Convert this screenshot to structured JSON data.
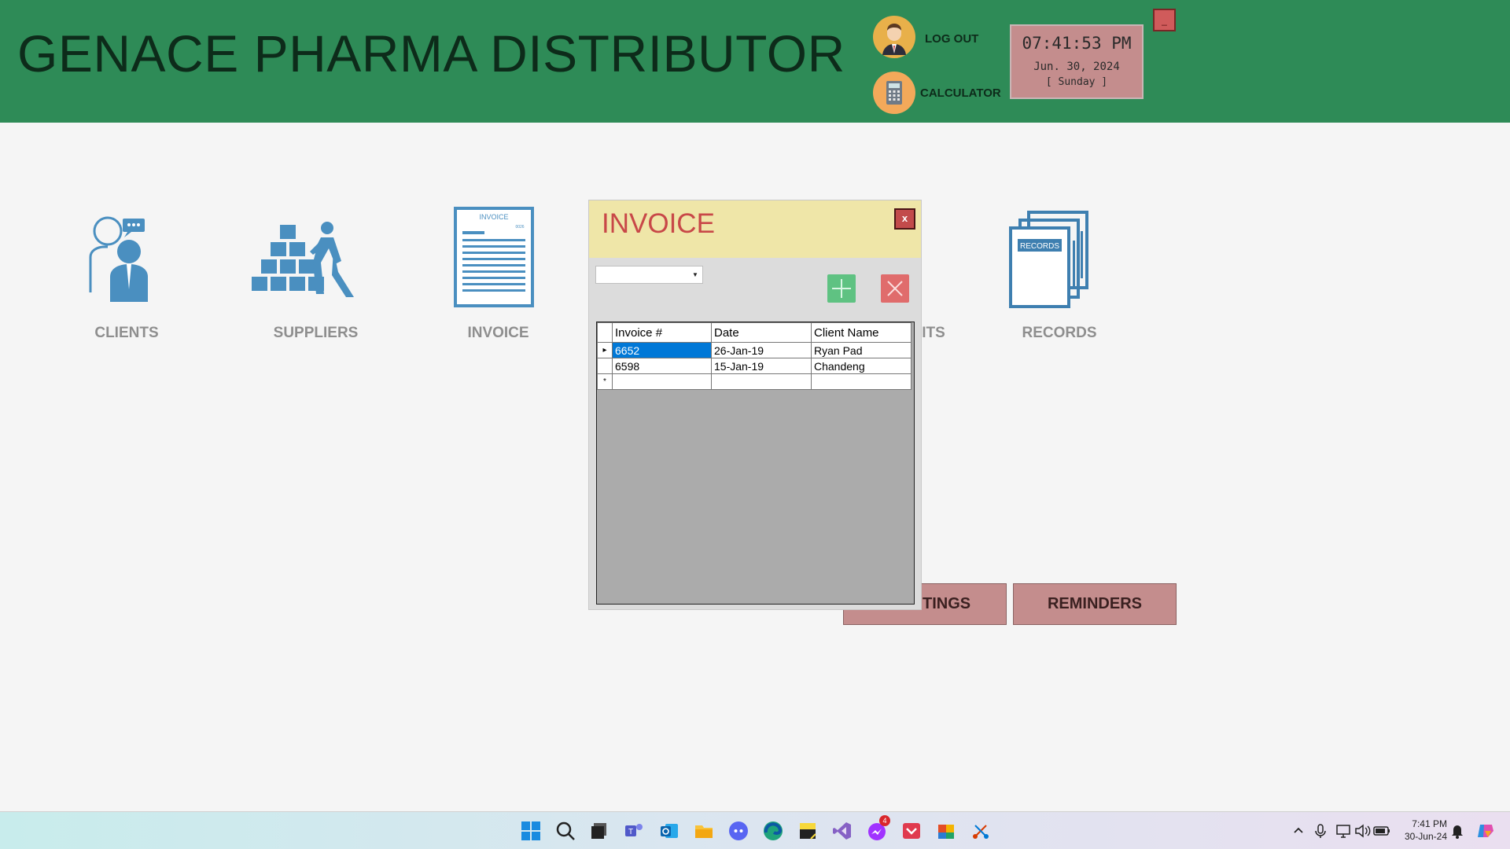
{
  "header": {
    "title": "GENACE PHARMA DISTRIBUTOR",
    "logout_label": "LOG OUT",
    "calculator_label": "CALCULATOR",
    "clock": {
      "time": "07:41:53 PM",
      "date": "Jun. 30, 2024",
      "day": "[ Sunday ]"
    },
    "minimize_label": "_"
  },
  "menu": {
    "clients": "CLIENTS",
    "suppliers": "SUPPLIERS",
    "invoice": "INVOICE",
    "payments_partial": "ITS",
    "records": "RECORDS",
    "invoice_icon_text": "INVOICE",
    "invoice_icon_num": "0026",
    "records_icon_text": "RECORDS"
  },
  "buttons": {
    "settings_partial": "TINGS",
    "reminders": "REMINDERS"
  },
  "dialog": {
    "title": "INVOICE",
    "close_label": "x",
    "dropdown_value": "",
    "columns": [
      "Invoice #",
      "Date",
      "Client Name"
    ],
    "rows": [
      {
        "invoice": "6652",
        "date": "26-Jan-19",
        "client": "Ryan Pad"
      },
      {
        "invoice": "6598",
        "date": "15-Jan-19",
        "client": "Chandeng"
      }
    ],
    "new_row_marker": "*",
    "current_row_marker": "▸"
  },
  "taskbar": {
    "time": "7:41 PM",
    "date": "30-Jun-24",
    "messenger_badge": "4",
    "icons": [
      "start-icon",
      "search-icon",
      "task-view-icon",
      "teams-icon",
      "outlook-icon",
      "file-explorer-icon",
      "discord-icon",
      "edge-icon",
      "sticky-notes-icon",
      "visual-studio-icon",
      "messenger-icon",
      "pocket-icon",
      "office-icon",
      "snipping-tool-icon"
    ]
  },
  "colors": {
    "header": "#2e8b57",
    "accent_blue": "#4a8fc0",
    "dialog_title": "#c84848",
    "button": "#c48d8d"
  }
}
